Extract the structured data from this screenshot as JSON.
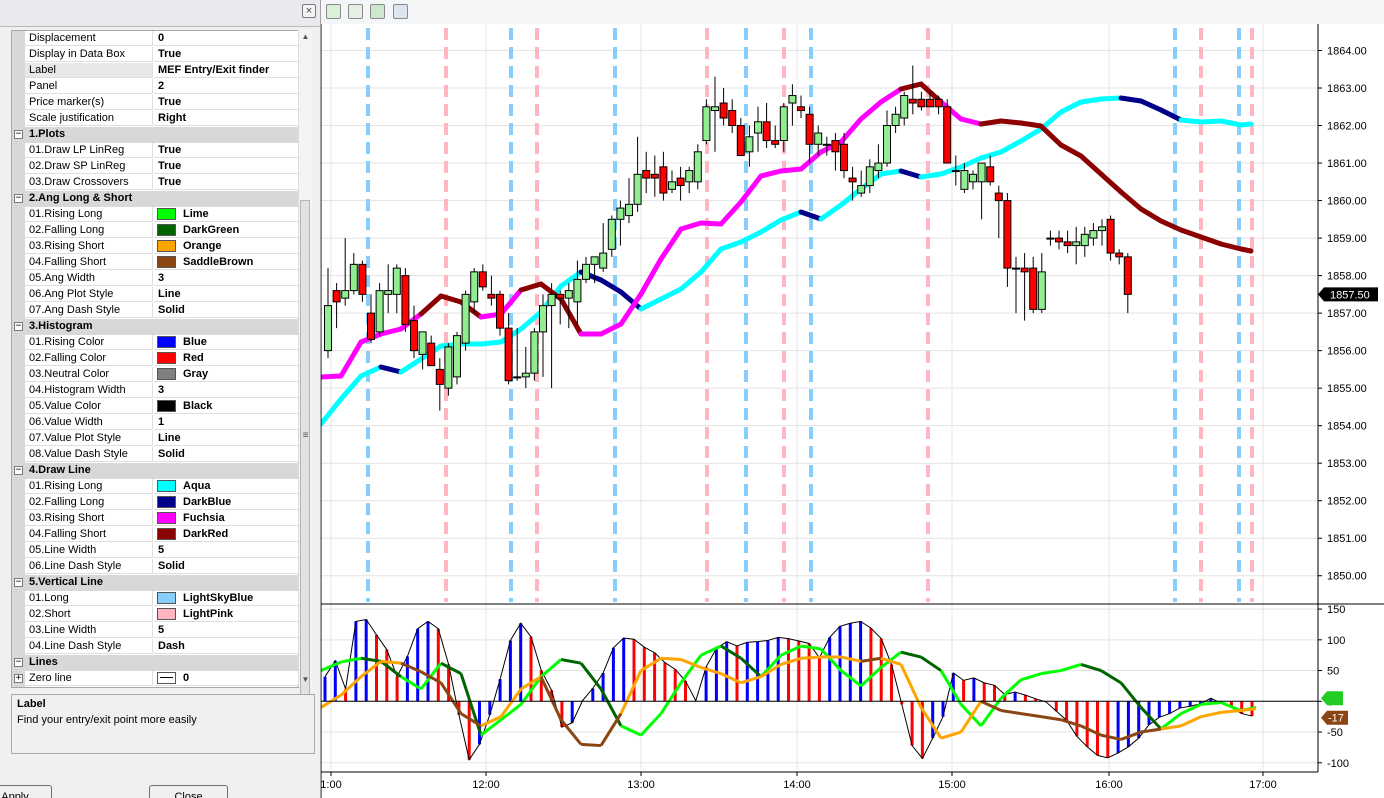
{
  "properties": {
    "title_close": "×",
    "rows": [
      {
        "kind": "prop",
        "name": "Displacement",
        "value": "0"
      },
      {
        "kind": "prop",
        "name": "Display in Data Box",
        "value": "True"
      },
      {
        "kind": "prop",
        "name": "Label",
        "value": "MEF Entry/Exit finder",
        "selected": true
      },
      {
        "kind": "prop",
        "name": "Panel",
        "value": "2"
      },
      {
        "kind": "prop",
        "name": "Price marker(s)",
        "value": "True"
      },
      {
        "kind": "prop",
        "name": "Scale justification",
        "value": "Right"
      },
      {
        "kind": "cat",
        "name": "1.Plots",
        "toggle": "−"
      },
      {
        "kind": "prop",
        "name": "01.Draw LP LinReg",
        "value": "True"
      },
      {
        "kind": "prop",
        "name": "02.Draw SP LinReg",
        "value": "True"
      },
      {
        "kind": "prop",
        "name": "03.Draw Crossovers",
        "value": "True"
      },
      {
        "kind": "cat",
        "name": "2.Ang Long & Short",
        "toggle": "−"
      },
      {
        "kind": "prop",
        "name": "01.Rising Long",
        "value": "Lime",
        "swatch": "#00ff00"
      },
      {
        "kind": "prop",
        "name": "02.Falling Long",
        "value": "DarkGreen",
        "swatch": "#006400"
      },
      {
        "kind": "prop",
        "name": "03.Rising Short",
        "value": "Orange",
        "swatch": "#ffa500"
      },
      {
        "kind": "prop",
        "name": "04.Falling Short",
        "value": "SaddleBrown",
        "swatch": "#8b4513"
      },
      {
        "kind": "prop",
        "name": "05.Ang Width",
        "value": "3"
      },
      {
        "kind": "prop",
        "name": "06.Ang Plot Style",
        "value": "Line"
      },
      {
        "kind": "prop",
        "name": "07.Ang Dash Style",
        "value": "Solid"
      },
      {
        "kind": "cat",
        "name": "3.Histogram",
        "toggle": "−"
      },
      {
        "kind": "prop",
        "name": "01.Rising Color",
        "value": "Blue",
        "swatch": "#0000ff"
      },
      {
        "kind": "prop",
        "name": "02.Falling Color",
        "value": "Red",
        "swatch": "#ff0000"
      },
      {
        "kind": "prop",
        "name": "03.Neutral Color",
        "value": "Gray",
        "swatch": "#808080"
      },
      {
        "kind": "prop",
        "name": "04.Histogram Width",
        "value": "3"
      },
      {
        "kind": "prop",
        "name": "05.Value Color",
        "value": "Black",
        "swatch": "#000000"
      },
      {
        "kind": "prop",
        "name": "06.Value Width",
        "value": "1"
      },
      {
        "kind": "prop",
        "name": "07.Value Plot Style",
        "value": "Line"
      },
      {
        "kind": "prop",
        "name": "08.Value Dash Style",
        "value": "Solid"
      },
      {
        "kind": "cat",
        "name": "4.Draw Line",
        "toggle": "−"
      },
      {
        "kind": "prop",
        "name": "01.Rising Long",
        "value": "Aqua",
        "swatch": "#00ffff"
      },
      {
        "kind": "prop",
        "name": "02.Falling Long",
        "value": "DarkBlue",
        "swatch": "#00008b"
      },
      {
        "kind": "prop",
        "name": "03.Rising Short",
        "value": "Fuchsia",
        "swatch": "#ff00ff"
      },
      {
        "kind": "prop",
        "name": "04.Falling Short",
        "value": "DarkRed",
        "swatch": "#8b0000"
      },
      {
        "kind": "prop",
        "name": "05.Line Width",
        "value": "5"
      },
      {
        "kind": "prop",
        "name": "06.Line Dash Style",
        "value": "Solid"
      },
      {
        "kind": "cat",
        "name": "5.Vertical Line",
        "toggle": "−"
      },
      {
        "kind": "prop",
        "name": "01.Long",
        "value": "LightSkyBlue",
        "swatch": "#87cefa"
      },
      {
        "kind": "prop",
        "name": "02.Short",
        "value": "LightPink",
        "swatch": "#ffb6c1"
      },
      {
        "kind": "prop",
        "name": "03.Line Width",
        "value": "5"
      },
      {
        "kind": "prop",
        "name": "04.Line Dash Style",
        "value": "Dash"
      },
      {
        "kind": "cat",
        "name": "Lines",
        "toggle": "−"
      },
      {
        "kind": "prop",
        "name": "Zero line",
        "value": "0",
        "swatch": "#ffffff",
        "expand": "+",
        "lineSwatch": true
      }
    ]
  },
  "description": {
    "title": "Label",
    "text": "Find your entry/exit point more easily"
  },
  "buttons": {
    "apply": "Apply",
    "close": "Close"
  },
  "toolbar": [
    "candles-icon",
    "line-chart-icon",
    "dollar-icon",
    "panel-icon"
  ],
  "chart_data": {
    "type": "candlestick",
    "time_labels": [
      "1:00",
      "12:00",
      "13:00",
      "14:00",
      "15:00",
      "16:00",
      "17:00"
    ],
    "price_axis": {
      "ticks": [
        "1864.00",
        "1863.00",
        "1862.00",
        "1861.00",
        "1860.00",
        "1859.00",
        "1858.00",
        "1857.00",
        "1856.00",
        "1855.00",
        "1854.00",
        "1853.00",
        "1852.00",
        "1851.00",
        "1850.00"
      ],
      "ylim": [
        1849.3,
        1864.6
      ]
    },
    "last_price": "1857.50",
    "osc_axis": {
      "ticks": [
        "150",
        "100",
        "50",
        "0",
        "-50",
        "-100"
      ],
      "ylim": [
        -115,
        155
      ]
    },
    "osc_markers": [
      "-17"
    ],
    "candles": [
      [
        1856.0,
        1858.2,
        1855.8,
        1857.2
      ],
      [
        1857.6,
        1857.8,
        1856.6,
        1857.3
      ],
      [
        1857.4,
        1859.0,
        1857.2,
        1857.6
      ],
      [
        1857.6,
        1858.6,
        1857.5,
        1858.3
      ],
      [
        1858.3,
        1858.4,
        1857.3,
        1857.5
      ],
      [
        1857.0,
        1857.5,
        1856.2,
        1856.3
      ],
      [
        1856.5,
        1857.8,
        1856.4,
        1857.6
      ],
      [
        1857.5,
        1858.3,
        1857.0,
        1857.6
      ],
      [
        1857.5,
        1858.3,
        1857.0,
        1858.2
      ],
      [
        1858.0,
        1858.2,
        1856.5,
        1856.7
      ],
      [
        1856.8,
        1857.2,
        1855.8,
        1856.0
      ],
      [
        1855.9,
        1856.5,
        1855.5,
        1856.5
      ],
      [
        1856.2,
        1856.4,
        1855.6,
        1855.6
      ],
      [
        1855.5,
        1855.8,
        1854.4,
        1855.1
      ],
      [
        1855.0,
        1856.2,
        1854.8,
        1856.1
      ],
      [
        1855.3,
        1856.5,
        1855.1,
        1856.4
      ],
      [
        1856.2,
        1857.6,
        1856.0,
        1857.5
      ],
      [
        1857.3,
        1858.2,
        1857.0,
        1858.1
      ],
      [
        1858.1,
        1858.3,
        1857.6,
        1857.7
      ],
      [
        1857.5,
        1858.0,
        1857.2,
        1857.4
      ],
      [
        1857.5,
        1857.6,
        1856.4,
        1856.6
      ],
      [
        1856.6,
        1857.0,
        1855.1,
        1855.2
      ],
      [
        1855.3,
        1856.6,
        1855.2,
        1855.3
      ],
      [
        1855.3,
        1856.1,
        1855.0,
        1855.4
      ],
      [
        1855.4,
        1856.6,
        1855.2,
        1856.5
      ],
      [
        1856.5,
        1857.5,
        1855.3,
        1857.2
      ],
      [
        1857.2,
        1857.8,
        1855.0,
        1857.5
      ],
      [
        1857.5,
        1857.6,
        1856.7,
        1857.4
      ],
      [
        1857.4,
        1857.8,
        1856.6,
        1857.6
      ],
      [
        1857.3,
        1858.4,
        1856.7,
        1857.9
      ],
      [
        1857.9,
        1858.5,
        1857.8,
        1858.3
      ],
      [
        1858.3,
        1858.5,
        1857.8,
        1858.5
      ],
      [
        1858.2,
        1859.4,
        1858.1,
        1858.6
      ],
      [
        1858.7,
        1859.6,
        1858.5,
        1859.5
      ],
      [
        1859.5,
        1860.0,
        1858.8,
        1859.8
      ],
      [
        1859.6,
        1860.6,
        1859.4,
        1859.9
      ],
      [
        1859.9,
        1861.7,
        1859.7,
        1860.7
      ],
      [
        1860.8,
        1861.3,
        1860.2,
        1860.6
      ],
      [
        1860.7,
        1861.2,
        1860.1,
        1860.6
      ],
      [
        1860.9,
        1861.3,
        1860.0,
        1860.2
      ],
      [
        1860.3,
        1860.8,
        1860.2,
        1860.5
      ],
      [
        1860.6,
        1860.9,
        1860.0,
        1860.4
      ],
      [
        1860.5,
        1860.9,
        1860.2,
        1860.8
      ],
      [
        1860.5,
        1861.5,
        1860.3,
        1861.3
      ],
      [
        1861.6,
        1862.7,
        1861.5,
        1862.5
      ],
      [
        1862.4,
        1863.3,
        1861.3,
        1862.5
      ],
      [
        1862.6,
        1863.0,
        1862.0,
        1862.2
      ],
      [
        1862.4,
        1862.7,
        1861.8,
        1862.0
      ],
      [
        1862.0,
        1862.2,
        1861.2,
        1861.2
      ],
      [
        1861.3,
        1862.0,
        1860.9,
        1861.7
      ],
      [
        1861.8,
        1862.5,
        1861.3,
        1862.1
      ],
      [
        1862.1,
        1862.6,
        1861.4,
        1861.6
      ],
      [
        1861.6,
        1862.0,
        1861.4,
        1861.5
      ],
      [
        1861.6,
        1862.6,
        1861.3,
        1862.5
      ],
      [
        1862.6,
        1863.1,
        1862.0,
        1862.8
      ],
      [
        1862.5,
        1862.8,
        1862.2,
        1862.4
      ],
      [
        1862.3,
        1862.5,
        1861.0,
        1861.5
      ],
      [
        1861.5,
        1862.0,
        1861.2,
        1861.8
      ],
      [
        1861.5,
        1861.7,
        1861.2,
        1861.5
      ],
      [
        1861.6,
        1861.8,
        1860.8,
        1861.3
      ],
      [
        1861.5,
        1861.8,
        1860.6,
        1860.8
      ],
      [
        1860.6,
        1860.9,
        1860.0,
        1860.5
      ],
      [
        1860.2,
        1860.8,
        1860.1,
        1860.4
      ],
      [
        1860.4,
        1861.1,
        1860.2,
        1860.9
      ],
      [
        1860.8,
        1861.5,
        1860.6,
        1861.0
      ],
      [
        1861.0,
        1862.4,
        1860.9,
        1862.0
      ],
      [
        1862.0,
        1862.5,
        1861.8,
        1862.3
      ],
      [
        1862.2,
        1862.9,
        1862.0,
        1862.8
      ],
      [
        1862.7,
        1863.6,
        1862.3,
        1862.6
      ],
      [
        1862.7,
        1862.9,
        1862.4,
        1862.5
      ],
      [
        1862.7,
        1862.9,
        1862.5,
        1862.5
      ],
      [
        1862.7,
        1862.8,
        1862.3,
        1862.5
      ],
      [
        1862.5,
        1862.7,
        1861.1,
        1861.0
      ],
      [
        1860.8,
        1861.2,
        1860.4,
        1860.8
      ],
      [
        1860.3,
        1861.0,
        1860.2,
        1860.8
      ],
      [
        1860.5,
        1860.8,
        1860.3,
        1860.7
      ],
      [
        1860.5,
        1861.0,
        1859.5,
        1861.0
      ],
      [
        1860.9,
        1861.2,
        1860.4,
        1860.5
      ],
      [
        1860.2,
        1860.4,
        1859.0,
        1860.0
      ],
      [
        1860.0,
        1860.2,
        1857.7,
        1858.2
      ],
      [
        1858.2,
        1858.5,
        1857.0,
        1858.2
      ],
      [
        1858.2,
        1858.6,
        1856.8,
        1858.1
      ],
      [
        1858.2,
        1858.5,
        1857.0,
        1857.1
      ],
      [
        1857.1,
        1858.6,
        1857.0,
        1858.1
      ],
      [
        1859.0,
        1859.2,
        1858.8,
        1859.0
      ],
      [
        1859.0,
        1859.2,
        1858.7,
        1858.9
      ],
      [
        1858.9,
        1859.2,
        1858.6,
        1858.8
      ],
      [
        1858.8,
        1859.3,
        1858.3,
        1858.9
      ],
      [
        1858.8,
        1859.3,
        1858.5,
        1859.1
      ],
      [
        1859.0,
        1859.4,
        1858.8,
        1859.2
      ],
      [
        1859.2,
        1859.5,
        1858.8,
        1859.3
      ],
      [
        1859.5,
        1859.6,
        1858.4,
        1858.6
      ],
      [
        1858.6,
        1858.7,
        1858.3,
        1858.5
      ],
      [
        1858.5,
        1858.6,
        1857.0,
        1857.5
      ]
    ],
    "long_signals": [
      5,
      24,
      37,
      51,
      61,
      69,
      87,
      103,
      109
    ],
    "short_signals": [
      15,
      29,
      45,
      53,
      72,
      65,
      91,
      111,
      107,
      116
    ],
    "osc_values": [
      40,
      66,
      20,
      130,
      133,
      108,
      84,
      40,
      73,
      118,
      130,
      118,
      60,
      -22,
      -95,
      -70,
      -22,
      36,
      99,
      127,
      105,
      50,
      18,
      -42,
      -35,
      1,
      21,
      46,
      87,
      103,
      101,
      88,
      79,
      63,
      52,
      33,
      1,
      56,
      86,
      97,
      90,
      96,
      97,
      99,
      104,
      102,
      98,
      94,
      71,
      104,
      122,
      127,
      130,
      119,
      102,
      60,
      -5,
      -72,
      -93,
      -60,
      -25,
      46,
      34,
      38,
      30,
      26,
      11,
      15,
      10,
      4,
      -1,
      -16,
      -31,
      -57,
      -74,
      -88,
      -92,
      -84,
      -74,
      -60,
      -38,
      -26,
      -20,
      -11,
      -8,
      -4,
      5,
      -3,
      -10,
      -20,
      -24
    ]
  }
}
